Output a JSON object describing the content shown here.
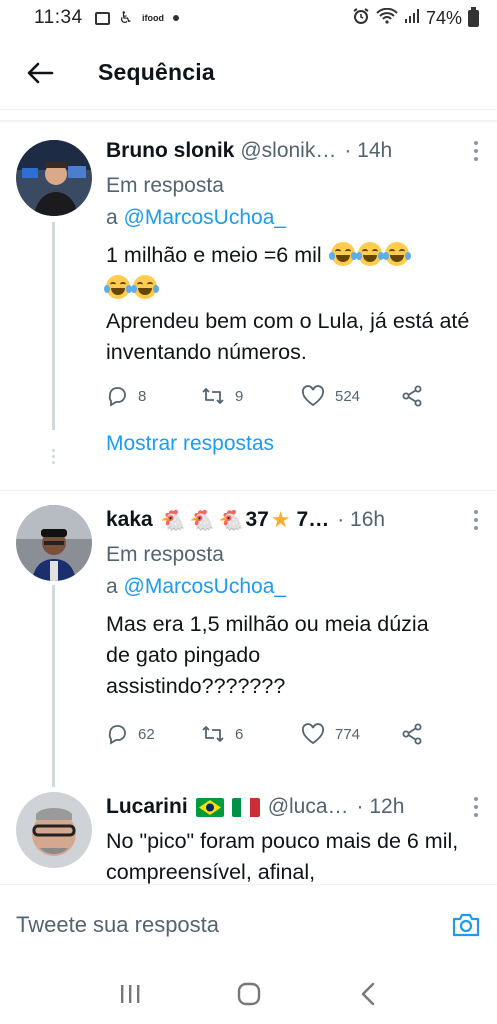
{
  "status_bar": {
    "time": "11:34",
    "battery": "74%",
    "app_label_small": "ifood"
  },
  "header": {
    "title": "Sequência"
  },
  "tweets": [
    {
      "name": "Bruno slonik",
      "handle": "@slonik…",
      "time": "· 14h",
      "reply_prefix": "Em resposta",
      "reply_a": "a ",
      "reply_mention": "@MarcosUchoa_",
      "text_line1": "1 milhão e meio =6 mil",
      "text_line3": "Aprendeu bem com o Lula, já está até inventando números.",
      "replies": "8",
      "retweets": "9",
      "likes": "524",
      "show_replies": "Mostrar respostas"
    },
    {
      "name": "kaka",
      "name_suffix": "37",
      "name_trail": "7…",
      "handle": "",
      "time": "· 16h",
      "reply_prefix": "Em resposta",
      "reply_a": "a ",
      "reply_mention": "@MarcosUchoa_",
      "text": "Mas era 1,5 milhão ou meia dúzia de gato pingado assistindo???????",
      "replies": "62",
      "retweets": "6",
      "likes": "774"
    },
    {
      "name": "Lucarini",
      "handle": "@luca…",
      "time": "· 12h",
      "text": "No \"pico\" foram pouco mais de 6 mil, compreensível, afinal,"
    }
  ],
  "composer": {
    "placeholder": "Tweete sua resposta"
  },
  "colors": {
    "accent": "#1d9bf0",
    "text": "#0f1419",
    "muted": "#536471",
    "divider": "#eff3f4"
  }
}
